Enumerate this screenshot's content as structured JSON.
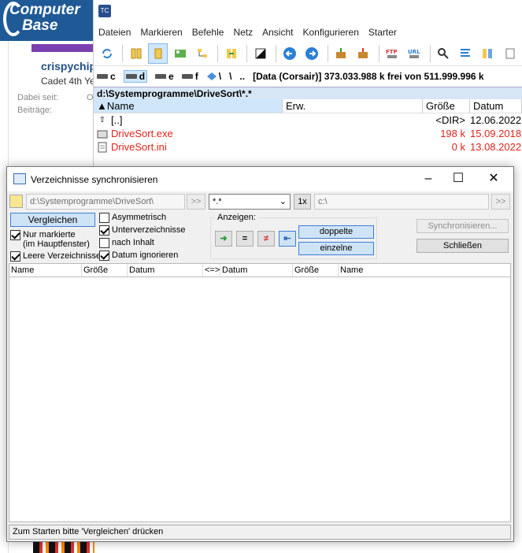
{
  "forum": {
    "logo_line1": "Computer",
    "logo_line2": "Base",
    "username": "crispychip",
    "rank": "Cadet 4th Ye",
    "since_label": "Dabei seit:",
    "since_value": "O",
    "posts_label": "Beiträge:"
  },
  "tc": {
    "menu": [
      "Dateien",
      "Markieren",
      "Befehle",
      "Netz",
      "Ansicht",
      "Konfigurieren",
      "Starter"
    ],
    "drives": [
      {
        "label": "c",
        "active": false
      },
      {
        "label": "d",
        "active": true
      },
      {
        "label": "e",
        "active": false
      },
      {
        "label": "f",
        "active": false
      },
      {
        "label": "\\",
        "active": false
      },
      {
        "label": "\\",
        "active": false
      },
      {
        "label": "..",
        "active": false
      }
    ],
    "drive_info": "[Data (Corsair)]  373.033.988 k frei von 511.999.996 k",
    "path": "d:\\Systemprogramme\\DriveSort\\*.*",
    "columns": {
      "name": "Name",
      "ext": "Erw.",
      "size": "Größe",
      "date": "Datum"
    },
    "files": [
      {
        "name": "[..]",
        "ext": "",
        "size": "<DIR>",
        "date": "12.06.2022",
        "red": false
      },
      {
        "name": "DriveSort.exe",
        "ext": "",
        "size": "198 k",
        "date": "15.09.2018",
        "red": true
      },
      {
        "name": "DriveSort.ini",
        "ext": "",
        "size": "0 k",
        "date": "13.08.2022",
        "red": true
      }
    ]
  },
  "dialog": {
    "title": "Verzeichnisse synchronisieren",
    "left_path": "d:\\Systemprogramme\\DriveSort\\",
    "left_browse": ">>",
    "filter": "*.*",
    "once_button": "1x",
    "right_path": "c:\\",
    "right_browse": ">>",
    "compare_button": "Vergleichen",
    "only_selected": "Nur markierte",
    "in_main_window": "(im Hauptfenster)",
    "empty_dirs": "Leere Verzeichnisse",
    "asymmetric": "Asymmetrisch",
    "subdirs": "Unterverzeichnisse",
    "by_content": "nach Inhalt",
    "ignore_date": "Datum ignorieren",
    "show_label": "Anzeigen:",
    "duplicates_button": "doppelte",
    "singles_button": "einzelne",
    "sync_button": "Synchronisieren...",
    "close_button": "Schließen",
    "grid_headers": [
      "Name",
      "Größe",
      "Datum",
      "<=>",
      "Datum",
      "Größe",
      "Name"
    ],
    "status": "Zum Starten bitte 'Vergleichen' drücken"
  }
}
